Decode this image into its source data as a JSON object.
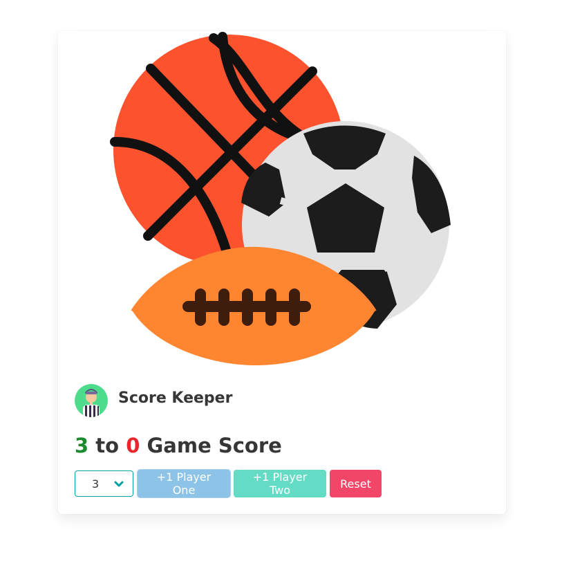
{
  "app": {
    "title": "Score Keeper"
  },
  "score": {
    "player_one": "3",
    "separator": "to",
    "player_two": "0",
    "label": "Game Score"
  },
  "controls": {
    "winning_score_selected": "3",
    "player_one_button": "+1 Player One",
    "player_two_button": "+1 Player Two",
    "reset_button": "Reset"
  },
  "colors": {
    "player_one_score": "#1e8a2f",
    "player_two_score": "#e8262e",
    "player_one_button": "#8cc3e6",
    "player_two_button": "#64dcc5",
    "reset_button": "#f14668",
    "select_border": "#00a3a3"
  },
  "icons": {
    "hero": "sports-balls-illustration",
    "avatar": "referee-avatar",
    "select": "chevron-down-icon"
  }
}
